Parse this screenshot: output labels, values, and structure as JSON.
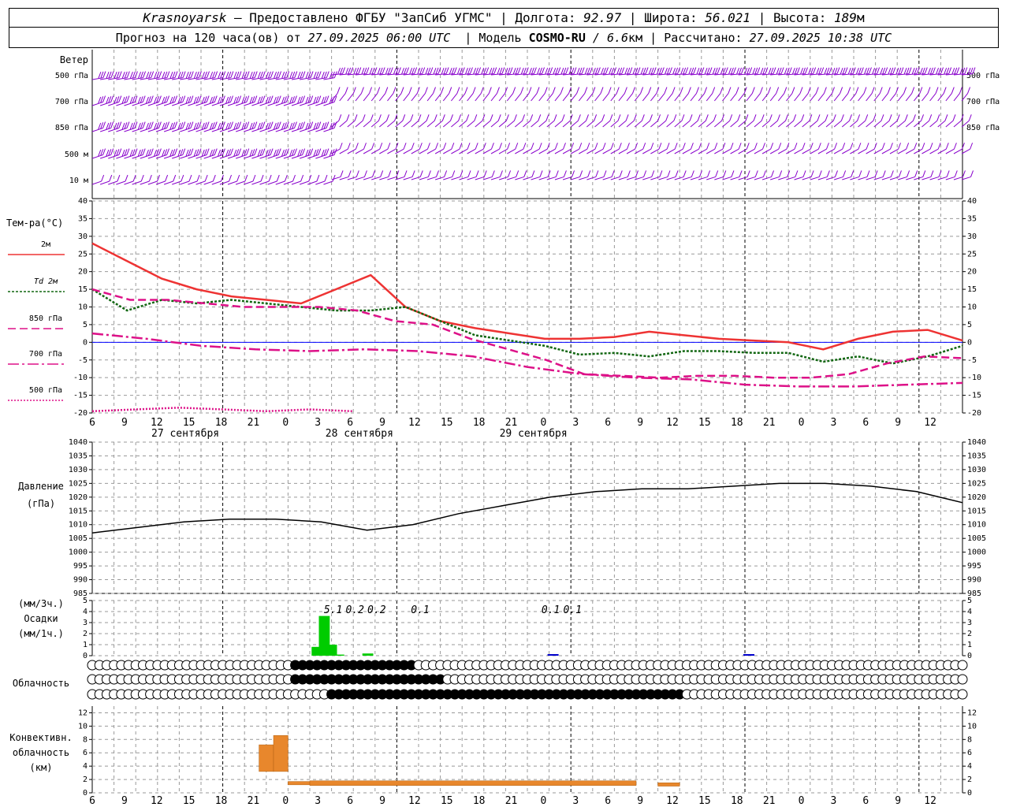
{
  "header": {
    "city": "Krasnoyarsk",
    "provider": " — Предоставлено ФГБУ \"ЗапСиб УГМС\" | Долгота: ",
    "lon": "92.97",
    "lat_label": " | Широта: ",
    "lat": "56.021",
    "alt_label": " | Высота: ",
    "alt": "189",
    "alt_unit": "м",
    "fc_label": "Прогноз на 120 часа(ов) от ",
    "fc_time": "27.09.2025 06:00 UTC",
    "model_label": "  | Модель ",
    "model": "COSMO-RU",
    "model_res": " / 6.6",
    "model_res_unit": "км",
    "calc_label": " | Рассчитано: ",
    "calc_time": "27.09.2025 10:38 UTC"
  },
  "colors": {
    "t2m": "#ee3333",
    "td2m": "#116611",
    "t850": "#dd1188",
    "t700": "#dd1188",
    "t500": "#dd1188",
    "pressure": "#000000",
    "precip_liquid": "#00cc00",
    "precip_blue": "#0000cc",
    "convective": "#e8872c",
    "wind": "#8800cc",
    "grid": "#999999",
    "zero_line": "#0000ff"
  },
  "chart_data": [
    {
      "type": "wind_barbs",
      "label": "Ветер",
      "levels": [
        "500 гПа",
        "700 гПа",
        "850 гПа",
        "500 м",
        "10 м"
      ],
      "direction_hours": [
        0,
        24,
        48,
        72,
        96,
        114
      ],
      "hour_labels": [
        "6",
        "9",
        "12",
        "15",
        "18",
        "21",
        "0",
        "3",
        "6",
        "9",
        "12",
        "15",
        "18",
        "21",
        "0",
        "3",
        "6",
        "9",
        "12",
        "15",
        "18",
        "21",
        "0",
        "3",
        "6",
        "9",
        "12"
      ]
    },
    {
      "type": "line",
      "ylabel": "Тем-ра(°C)",
      "ylim": [
        -20,
        40
      ],
      "yticks": [
        -20,
        -15,
        -10,
        -5,
        0,
        5,
        10,
        15,
        20,
        25,
        30,
        35,
        40
      ],
      "date_labels": [
        "27 сентября",
        "28 сентября",
        "29 сентября"
      ],
      "x_hours": [
        0,
        3,
        6,
        9,
        12,
        15,
        18,
        21,
        24,
        27,
        30,
        33,
        36,
        39,
        42,
        45,
        48,
        51,
        54,
        57,
        60,
        63,
        66,
        69,
        72,
        75,
        78,
        81,
        84,
        87,
        90,
        93,
        96,
        99,
        102,
        105,
        108,
        111,
        114
      ],
      "series": [
        {
          "name": "2м",
          "style": "solid",
          "values": [
            28,
            23,
            18,
            15,
            13,
            12,
            11,
            15,
            19,
            10,
            6,
            4,
            2.5,
            1,
            1,
            1.5,
            3,
            2,
            1,
            0.5,
            0,
            -2,
            1,
            3,
            3.5,
            0.5
          ]
        },
        {
          "name": "Td  2м",
          "style": "dotted",
          "values": [
            15,
            9,
            12,
            11,
            12,
            11,
            10,
            9,
            9,
            10,
            6,
            2,
            0.5,
            -1,
            -3.5,
            -3,
            -4,
            -2.5,
            -2.5,
            -3,
            -3,
            -5.5,
            -4,
            -6,
            -4,
            -1
          ]
        },
        {
          "name": "850 гПа",
          "style": "dash",
          "values": [
            15,
            12,
            12,
            11,
            10,
            10,
            10,
            9,
            6,
            5,
            1,
            -2,
            -5,
            -9,
            -9.5,
            -10,
            -9.5,
            -9.5,
            -10,
            -10,
            -9,
            -6,
            -4,
            -4.5
          ]
        },
        {
          "name": "700 гПа",
          "style": "dashdot",
          "values": [
            2.5,
            1,
            -1,
            -2,
            -2.5,
            -2,
            -2.5,
            -4,
            -7,
            -9,
            -10,
            -10.5,
            -12,
            -12.5,
            -12.5,
            -12,
            -11.5
          ]
        },
        {
          "name": "500 гПа",
          "style": "dense-dot",
          "values": [
            -19.5,
            -19,
            -18.5,
            -19,
            -19.5,
            -19,
            -19.5
          ]
        }
      ]
    },
    {
      "type": "line",
      "ylabel": "Давление",
      "yunit": "(гПа)",
      "ylim": [
        985,
        1040
      ],
      "yticks": [
        985,
        990,
        995,
        1000,
        1005,
        1010,
        1015,
        1020,
        1025,
        1030,
        1035,
        1040
      ],
      "values": [
        1007,
        1009,
        1011,
        1012,
        1012,
        1011,
        1008,
        1010,
        1014,
        1017,
        1020,
        1022,
        1023,
        1023,
        1024,
        1025,
        1025,
        1024,
        1022,
        1018
      ]
    },
    {
      "type": "bar",
      "ylabel": "(мм/3ч.)",
      "title": "Осадки",
      "yunit": "(мм/1ч.)",
      "ylim": [
        0,
        5
      ],
      "annotations": [
        {
          "hour": 33,
          "text": "5.1"
        },
        {
          "hour": 36,
          "text": "0.2"
        },
        {
          "hour": 39,
          "text": "0.2"
        },
        {
          "hour": 45,
          "text": "0.1"
        },
        {
          "hour": 63,
          "text": "0.1"
        },
        {
          "hour": 66,
          "text": "0.1"
        }
      ],
      "bars": [
        {
          "hour": 31,
          "value": 0.8
        },
        {
          "hour": 32,
          "value": 3.6
        },
        {
          "hour": 33,
          "value": 1
        },
        {
          "hour": 34,
          "value": 0.1
        },
        {
          "hour": 38,
          "value": 0.2
        }
      ]
    },
    {
      "type": "table",
      "label": "Облачность",
      "rows": 3,
      "step_hours": 1
    },
    {
      "type": "bar",
      "ylabel": "Конвективн.",
      "ylabel2": "облачность",
      "yunit": "(км)",
      "ylim": [
        0,
        13
      ],
      "yticks": [
        0,
        2,
        4,
        6,
        8,
        10,
        12
      ],
      "bars": [
        {
          "hour_from": 23,
          "hour_to": 25,
          "bottom": 3.2,
          "top": 7.2
        },
        {
          "hour_from": 25,
          "hour_to": 27,
          "bottom": 3.2,
          "top": 8.6
        },
        {
          "hour_from": 27,
          "hour_to": 30,
          "bottom": 1.2,
          "top": 1.7
        },
        {
          "hour_from": 30,
          "hour_to": 75,
          "bottom": 1.1,
          "top": 1.8
        },
        {
          "hour_from": 78,
          "hour_to": 81,
          "bottom": 1,
          "top": 1.5
        }
      ]
    }
  ]
}
